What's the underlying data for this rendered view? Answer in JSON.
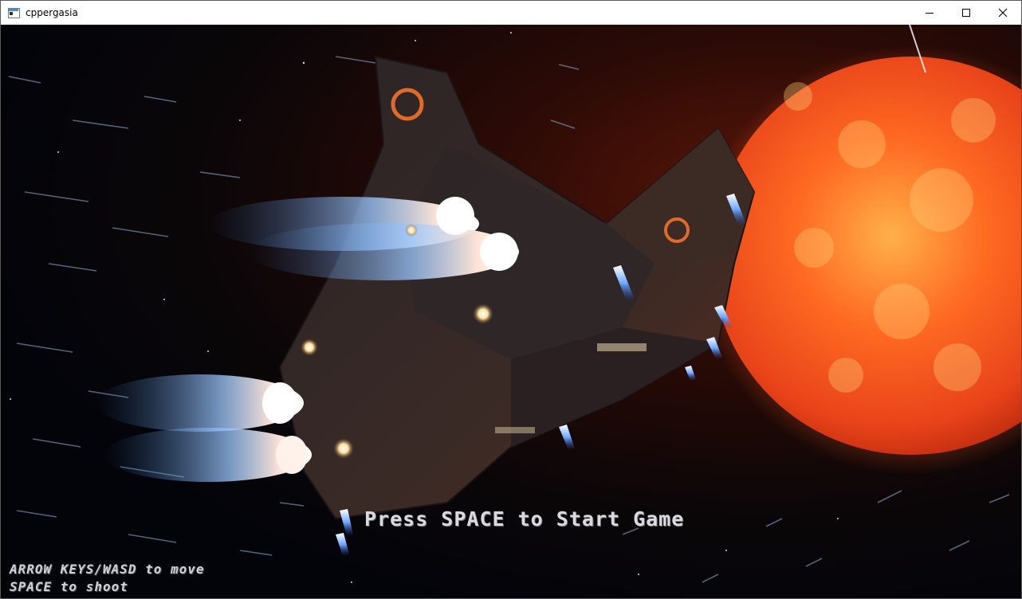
{
  "window": {
    "title": "cppergasia",
    "controls": {
      "minimize": "minimize",
      "maximize": "maximize",
      "close": "close"
    }
  },
  "game": {
    "start_prompt": "Press SPACE to Start Game",
    "controls_help": [
      "ARROW KEYS/WASD to move",
      "SPACE to shoot"
    ]
  },
  "colors": {
    "sun": "#e8431a",
    "sun_glow": "#ff7a2a",
    "space": "#05070d",
    "engine_glow": "#a9d6ff",
    "text": "#d9d9df"
  }
}
